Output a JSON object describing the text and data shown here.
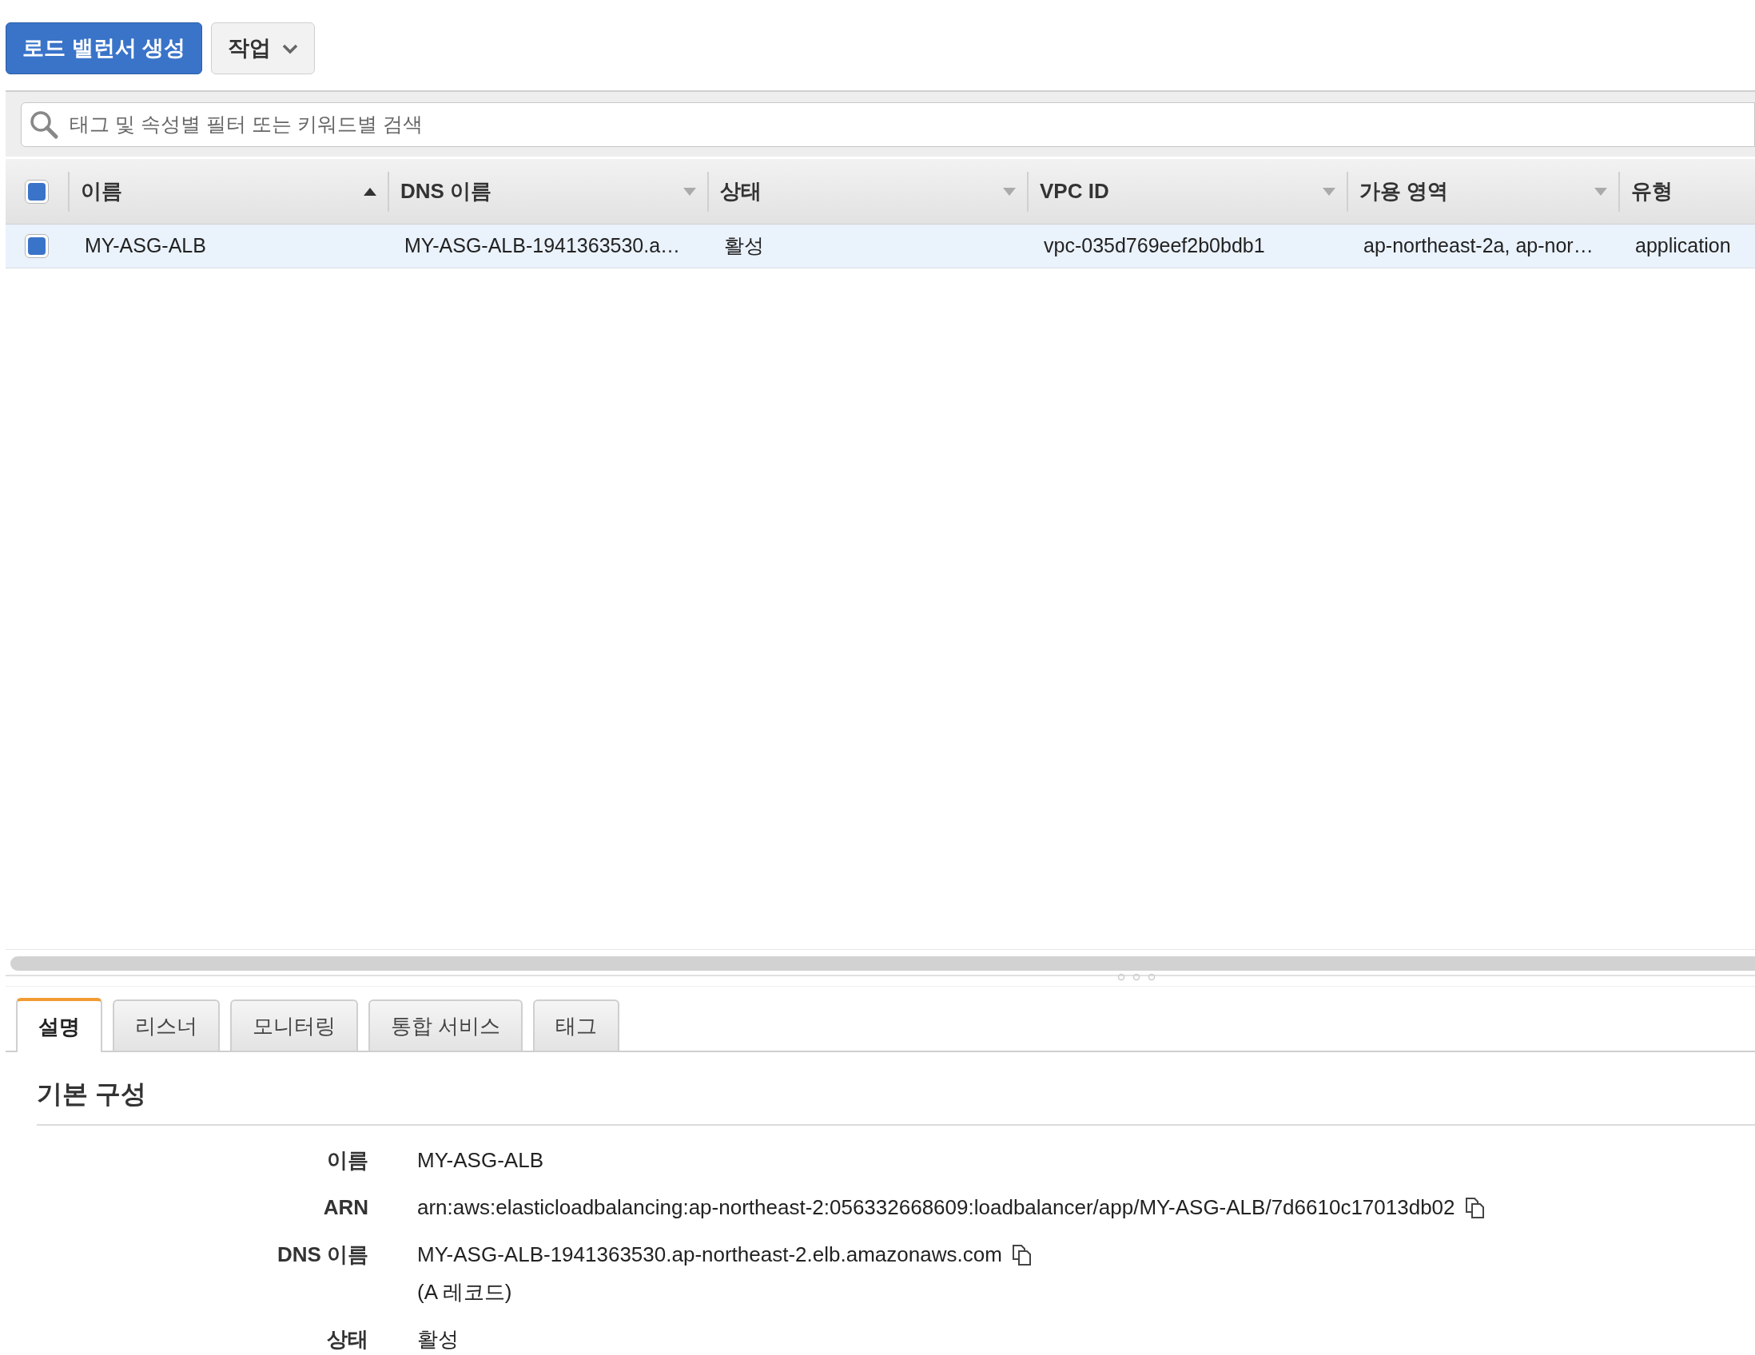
{
  "toolbar": {
    "create_button": "로드 밸런서 생성",
    "actions_button": "작업"
  },
  "search": {
    "placeholder": "태그 및 속성별 필터 또는 키워드별 검색"
  },
  "table": {
    "select_all_checked": true,
    "columns": [
      {
        "label": "이름",
        "sorted": true
      },
      {
        "label": "DNS 이름",
        "sorted": false
      },
      {
        "label": "상태",
        "sorted": false
      },
      {
        "label": "VPC ID",
        "sorted": false
      },
      {
        "label": "가용 영역",
        "sorted": false
      },
      {
        "label": "유형"
      }
    ],
    "rows": [
      {
        "selected": true,
        "checked": true,
        "cells": [
          "MY-ASG-ALB",
          "MY-ASG-ALB-1941363530.a…",
          "활성",
          "vpc-035d769eef2b0bdb1",
          "ap-northeast-2a, ap-nor…",
          "application"
        ]
      }
    ]
  },
  "tabs": [
    {
      "label": "설명",
      "selected": true
    },
    {
      "label": "리스너",
      "selected": false
    },
    {
      "label": "모니터링",
      "selected": false
    },
    {
      "label": "통합 서비스",
      "selected": false
    },
    {
      "label": "태그",
      "selected": false
    }
  ],
  "details": {
    "heading": "기본 구성",
    "fields": [
      {
        "label": "이름",
        "value": "MY-ASG-ALB",
        "copyable": false
      },
      {
        "label": "ARN",
        "value": "arn:aws:elasticloadbalancing:ap-northeast-2:056332668609:loadbalancer/app/MY-ASG-ALB/7d6610c17013db02",
        "copyable": true
      },
      {
        "label": "DNS 이름",
        "value": "MY-ASG-ALB-1941363530.ap-northeast-2.elb.amazonaws.com",
        "copyable": true,
        "note": "(A 레코드)"
      },
      {
        "label": "상태",
        "value": "활성",
        "copyable": false
      }
    ]
  }
}
